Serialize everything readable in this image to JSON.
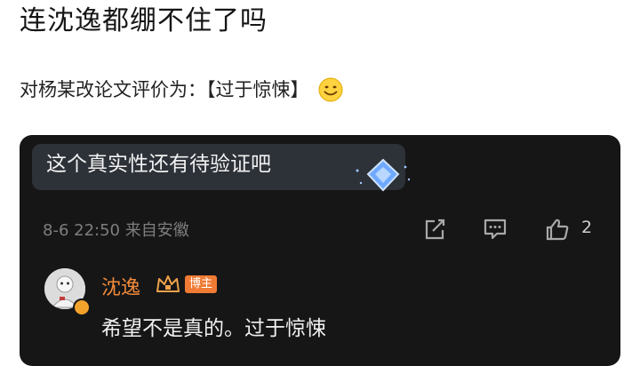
{
  "post": {
    "title": "连沈逸都绷不住了吗",
    "description": "对杨某改论文评价为：【过于惊悚】"
  },
  "comment": {
    "text": "这个真实性还有待验证吧",
    "meta": "8-6 22:50 来自安徽",
    "like_count": "2"
  },
  "reply": {
    "author": "沈逸",
    "badge": "博主",
    "text": "希望不是真的。过于惊悚"
  },
  "icons": [
    "smile-emoji-icon",
    "diamond-icon",
    "share-icon",
    "comment-icon",
    "like-icon",
    "crown-icon"
  ],
  "colors": {
    "card_bg": "#161616",
    "bubble_bg": "#2d3138",
    "author_name": "#f08a3a",
    "badge_bg": "#f07b35"
  }
}
